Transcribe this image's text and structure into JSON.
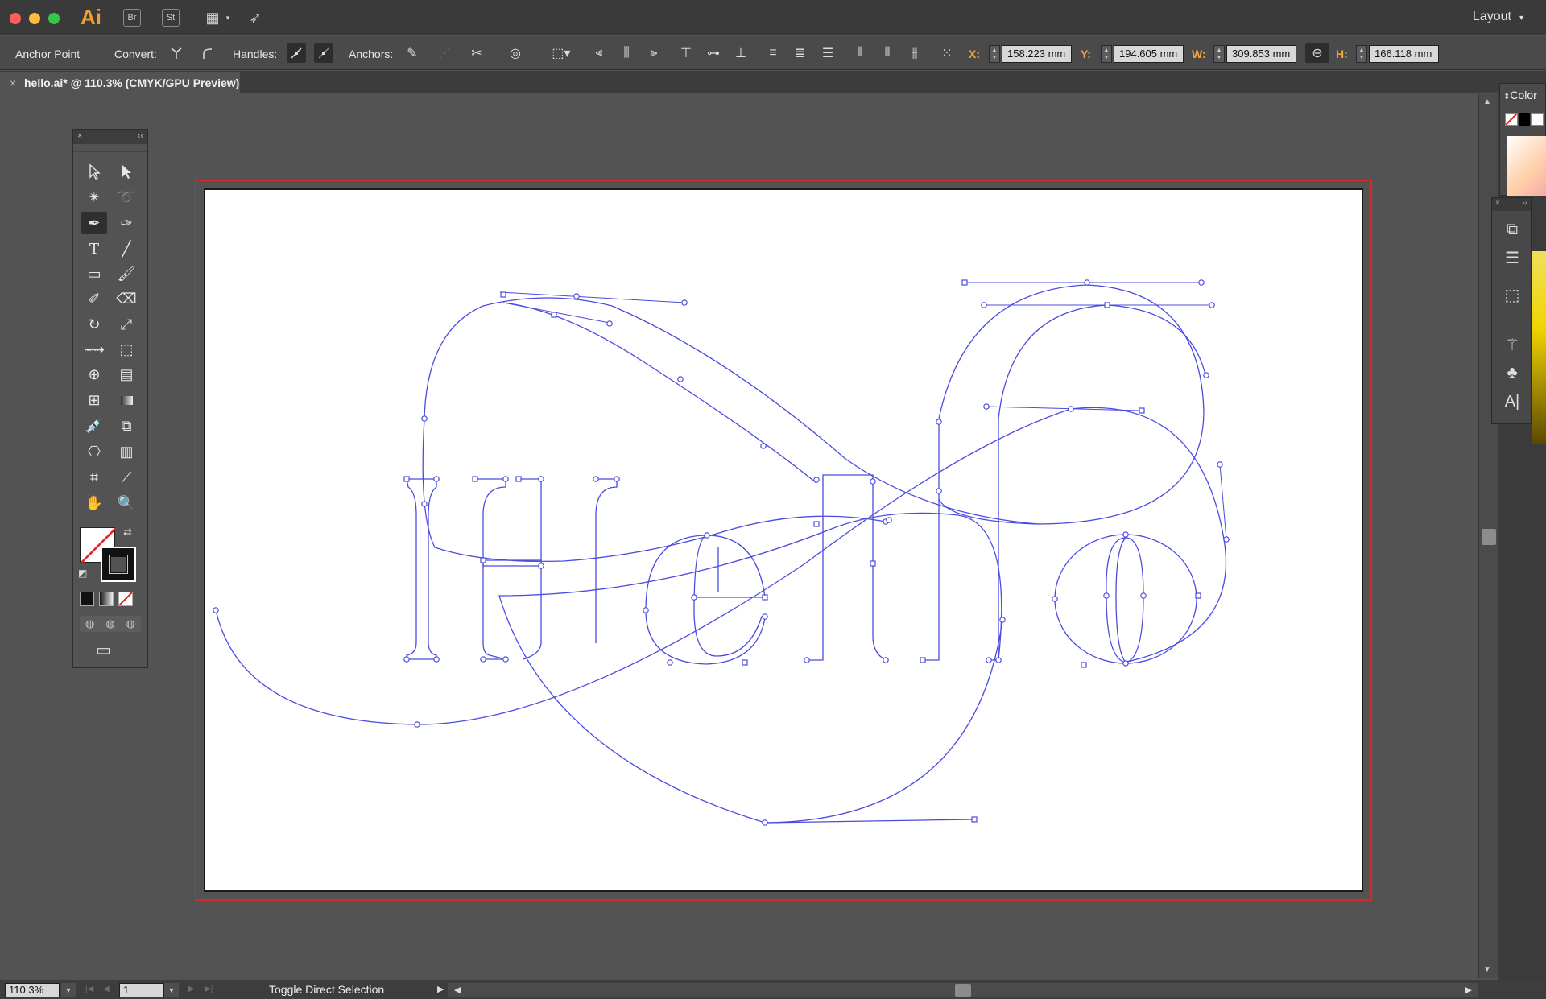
{
  "app": {
    "logo": "Ai",
    "bridge_label": "Br",
    "stock_label": "St",
    "workspace": "Layout"
  },
  "control_bar": {
    "anchor_point_label": "Anchor Point",
    "convert_label": "Convert:",
    "handles_label": "Handles:",
    "anchors_label": "Anchors:",
    "x_label": "X:",
    "x_value": "158.223 mm",
    "y_label": "Y:",
    "y_value": "194.605 mm",
    "w_label": "W:",
    "w_value": "309.853 mm",
    "h_label": "H:",
    "h_value": "166.118 mm"
  },
  "document": {
    "tab_title": "hello.ai* @ 110.3% (CMYK/GPU Preview)",
    "close_symbol": "×"
  },
  "artwork": {
    "path_color": "#4b4be0",
    "bleed_color": "#d12a2a",
    "glyphs": [
      "H",
      "e",
      "l",
      "l",
      "o"
    ]
  },
  "color_panel": {
    "title": "Color"
  },
  "status_bar": {
    "zoom": "110.3%",
    "page": "1",
    "status_text": "Toggle Direct Selection"
  },
  "icons": {
    "tools": [
      "selection-icon",
      "direct-selection-icon",
      "magic-wand-icon",
      "lasso-icon",
      "pen-icon",
      "curvature-icon",
      "type-icon",
      "line-icon",
      "rectangle-icon",
      "paintbrush-icon",
      "shaper-icon",
      "eraser-icon",
      "rotate-icon",
      "scale-icon",
      "width-icon",
      "free-transform-icon",
      "shape-builder-icon",
      "perspective-grid-icon",
      "mesh-icon",
      "gradient-icon",
      "eyedropper-icon",
      "blend-icon",
      "symbol-sprayer-icon",
      "column-graph-icon",
      "artboard-icon",
      "slice-icon",
      "hand-icon",
      "zoom-icon"
    ]
  }
}
